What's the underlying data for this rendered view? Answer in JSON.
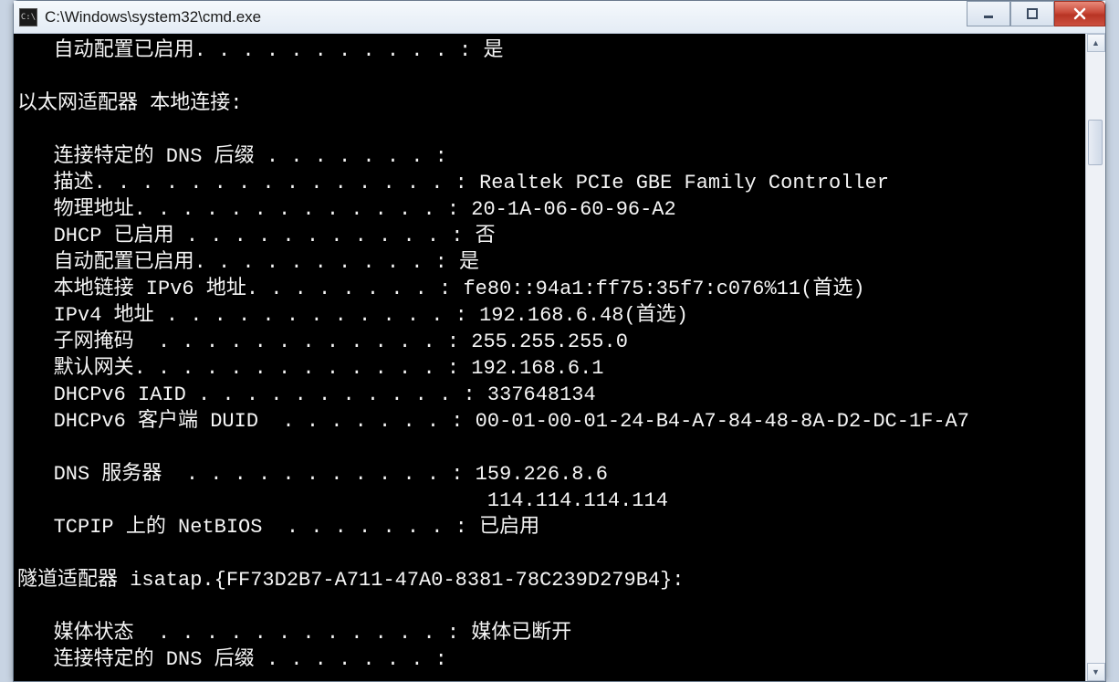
{
  "window": {
    "title": "C:\\Windows\\system32\\cmd.exe",
    "icon_label": "C:\\"
  },
  "terminal": {
    "lines": {
      "autoconfig_top": "   自动配置已启用. . . . . . . . . . . : 是",
      "blank1": "",
      "adapter_header": "以太网适配器 本地连接:",
      "blank2": "",
      "dns_suffix": "   连接特定的 DNS 后缀 . . . . . . . :",
      "description": "   描述. . . . . . . . . . . . . . . : Realtek PCIe GBE Family Controller",
      "physical_addr": "   物理地址. . . . . . . . . . . . . : 20-1A-06-60-96-A2",
      "dhcp_enabled": "   DHCP 已启用 . . . . . . . . . . . : 否",
      "autoconfig": "   自动配置已启用. . . . . . . . . . : 是",
      "ipv6_local": "   本地链接 IPv6 地址. . . . . . . . : fe80::94a1:ff75:35f7:c076%11(首选)",
      "ipv4_addr": "   IPv4 地址 . . . . . . . . . . . . : 192.168.6.48(首选)",
      "subnet": "   子网掩码  . . . . . . . . . . . . : 255.255.255.0",
      "gateway": "   默认网关. . . . . . . . . . . . . : 192.168.6.1",
      "dhcpv6_iaid": "   DHCPv6 IAID . . . . . . . . . . . : 337648134",
      "dhcpv6_duid": "   DHCPv6 客户端 DUID  . . . . . . . : 00-01-00-01-24-B4-A7-84-48-8A-D2-DC-1F-A7",
      "blank3": "",
      "dns_servers": "   DNS 服务器  . . . . . . . . . . . : 159.226.8.6",
      "dns_servers2": "                                       114.114.114.114",
      "netbios": "   TCPIP 上的 NetBIOS  . . . . . . . : 已启用",
      "blank4": "",
      "tunnel_header": "隧道适配器 isatap.{FF73D2B7-A711-47A0-8381-78C239D279B4}:",
      "blank5": "",
      "media_state": "   媒体状态  . . . . . . . . . . . . : 媒体已断开",
      "dns_suffix2": "   连接特定的 DNS 后缀 . . . . . . . :"
    }
  }
}
